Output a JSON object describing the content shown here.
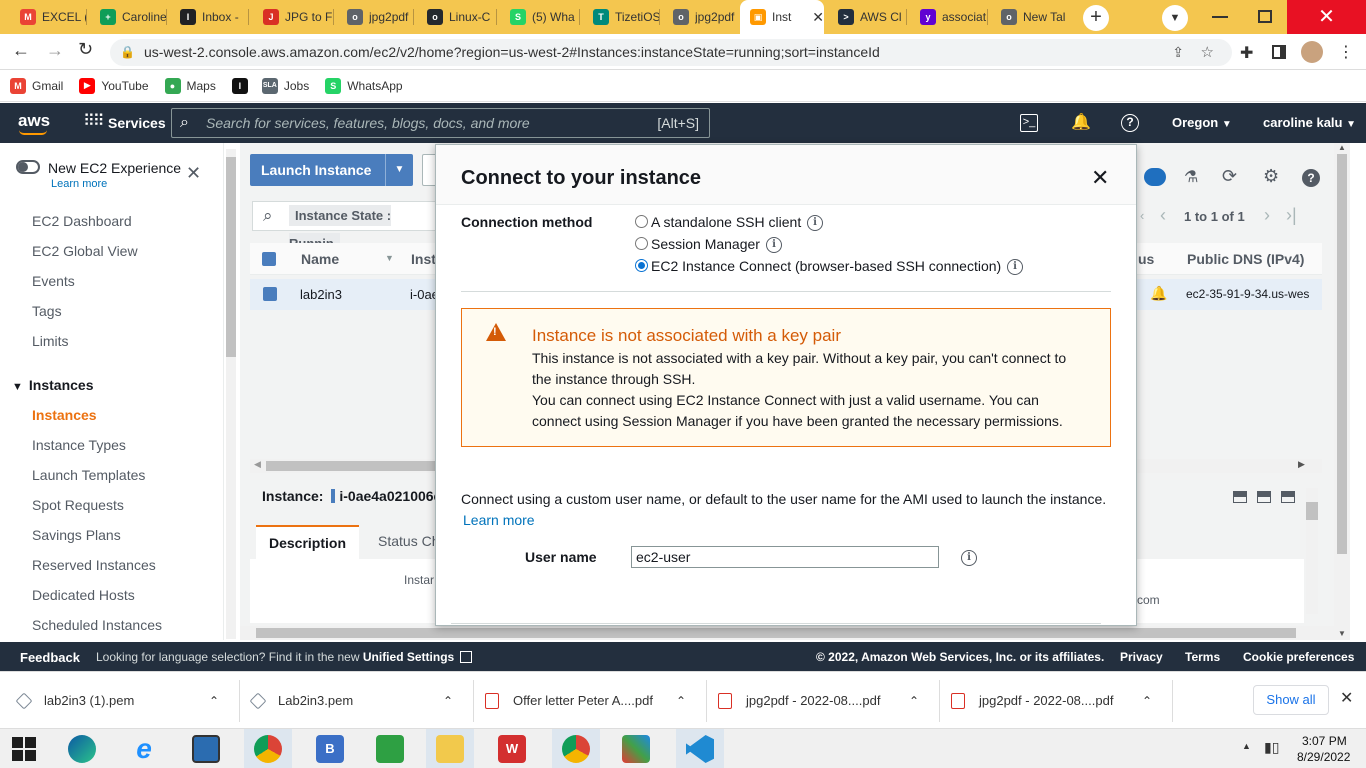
{
  "browser": {
    "tabs": [
      {
        "label": "EXCEL (",
        "color": "#ea4335",
        "glyph": "M"
      },
      {
        "label": "Caroline",
        "color": "#0f9d58",
        "glyph": "+"
      },
      {
        "label": "Inbox -",
        "color": "#202124",
        "glyph": "I"
      },
      {
        "label": "JPG to F",
        "color": "#d93025",
        "glyph": "J"
      },
      {
        "label": "jpg2pdf",
        "color": "#5f6368",
        "glyph": "o"
      },
      {
        "label": "Linux-C",
        "color": "#24292e",
        "glyph": "o"
      },
      {
        "label": "(5) Wha",
        "color": "#25d366",
        "glyph": "S"
      },
      {
        "label": "TizetiOS",
        "color": "#00897b",
        "glyph": "T"
      },
      {
        "label": "jpg2pdf",
        "color": "#5f6368",
        "glyph": "o"
      },
      {
        "label": "Inst",
        "color": "#ff9900",
        "glyph": "▣",
        "active": true
      },
      {
        "label": "AWS Cl",
        "color": "#232f3e",
        "glyph": ">"
      },
      {
        "label": "associat",
        "color": "#6001d2",
        "glyph": "y"
      },
      {
        "label": "New Tal",
        "color": "#5f6368",
        "glyph": "o"
      }
    ],
    "url": "us-west-2.console.aws.amazon.com/ec2/v2/home?region=us-west-2#Instances:instanceState=running;sort=instanceId",
    "bookmarks": [
      {
        "label": "Gmail",
        "color": "#ea4335",
        "glyph": "M"
      },
      {
        "label": "YouTube",
        "color": "#ff0000",
        "glyph": "▶"
      },
      {
        "label": "Maps",
        "color": "#34a853",
        "glyph": "●"
      },
      {
        "label": "",
        "color": "#111111",
        "glyph": "I"
      },
      {
        "label": "Jobs",
        "color": "#5b6770",
        "glyph": "SLA"
      },
      {
        "label": "WhatsApp",
        "color": "#25d366",
        "glyph": "S"
      }
    ]
  },
  "aws_nav": {
    "logo": "aws",
    "services": "Services",
    "search_placeholder": "Search for services, features, blogs, docs, and more",
    "search_shortcut": "[Alt+S]",
    "region": "Oregon",
    "user": "caroline kalu"
  },
  "sidebar": {
    "new_experience": "New EC2 Experience",
    "learn_more": "Learn more",
    "items": [
      "EC2 Dashboard",
      "EC2 Global View",
      "Events",
      "Tags",
      "Limits"
    ],
    "section": "Instances",
    "section_items": [
      "Instances",
      "Instance Types",
      "Launch Templates",
      "Spot Requests",
      "Savings Plans",
      "Reserved Instances",
      "Dedicated Hosts",
      "Scheduled Instances"
    ]
  },
  "content": {
    "launch_button": "Launch Instance",
    "filter_text": "Instance State : Runnin",
    "pagination": "1 to 1 of 1",
    "columns": {
      "name": "Name",
      "instance": "Inst",
      "status_partial": "us",
      "public_dns": "Public DNS (IPv4)"
    },
    "row": {
      "name": "lab2in3",
      "instance_id_partial": "i-0ae",
      "public_dns": "ec2-35-91-9-34.us-wes"
    },
    "instance_label": "Instance:",
    "instance_id": "i-0ae4a021006c",
    "tab_description": "Description",
    "tab_status": "Status Ch",
    "detail_partial": "Instar",
    "detail_com": "com"
  },
  "modal": {
    "title": "Connect to your instance",
    "connection_method_label": "Connection method",
    "options": [
      "A standalone SSH client",
      "Session Manager",
      "EC2 Instance Connect (browser-based SSH connection)"
    ],
    "selected_option": "EC2 Instance Connect (browser-based SSH connection)",
    "warning_title": "Instance is not associated with a key pair",
    "warning_lines": [
      "This instance is not associated with a key pair. Without a key pair, you can't connect to",
      "the instance through SSH.",
      "You can connect using EC2 Instance Connect with just a valid username. You can",
      "connect using Session Manager if you have been granted the necessary permissions."
    ],
    "connect_text": "Connect using a custom user name, or default to the user name for the AMI used to launch the instance.",
    "learn_more": "Learn more",
    "username_label": "User name",
    "username_value": "ec2-user"
  },
  "footer": {
    "feedback": "Feedback",
    "language_text": "Looking for language selection? Find it in the new",
    "unified_settings": "Unified Settings",
    "copyright": "© 2022, Amazon Web Services, Inc. or its affiliates.",
    "privacy": "Privacy",
    "terms": "Terms",
    "cookie": "Cookie preferences"
  },
  "downloads": {
    "items": [
      "lab2in3 (1).pem",
      "Lab2in3.pem",
      "Offer letter Peter A....pdf",
      "jpg2pdf - 2022-08....pdf",
      "jpg2pdf - 2022-08....pdf"
    ],
    "show_all": "Show all"
  },
  "taskbar": {
    "time": "3:07 PM",
    "date": "8/29/2022"
  }
}
